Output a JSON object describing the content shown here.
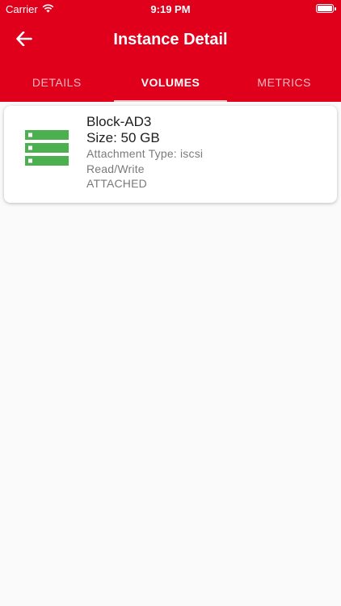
{
  "status_bar": {
    "carrier": "Carrier",
    "time": "9:19 PM"
  },
  "app_bar": {
    "title": "Instance Detail"
  },
  "tabs": [
    {
      "label": "DETAILS",
      "active": false
    },
    {
      "label": "VOLUMES",
      "active": true
    },
    {
      "label": "METRICS",
      "active": false
    }
  ],
  "volume": {
    "name": "Block-AD3",
    "size": "Size: 50 GB",
    "attachment_type": "Attachment Type: iscsi",
    "access": "Read/Write",
    "state": "ATTACHED",
    "icon": "storage-icon"
  },
  "colors": {
    "header": "#e0001b",
    "icon_green": "#4caf50",
    "background": "#fafafa"
  }
}
